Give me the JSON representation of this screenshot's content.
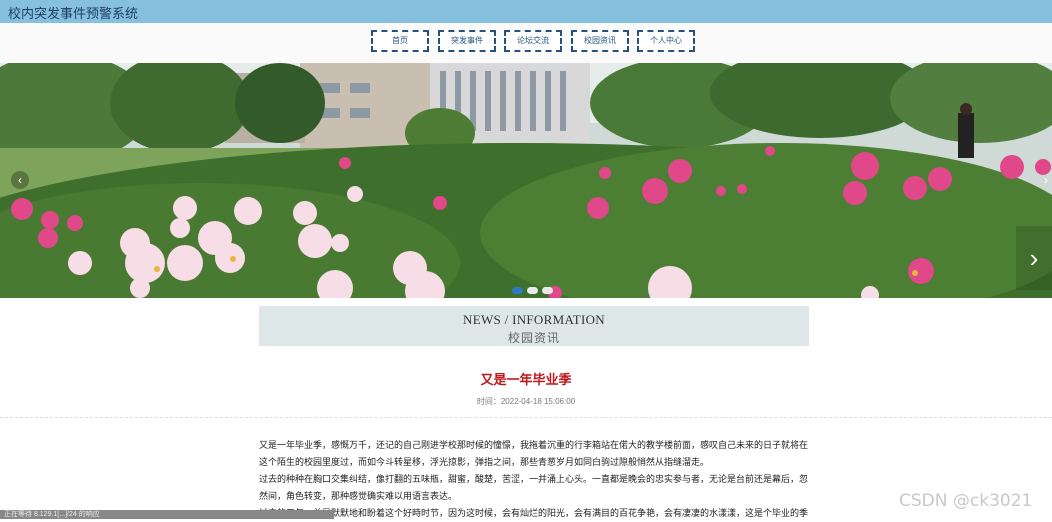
{
  "header": {
    "title": "校内突发事件预警系统"
  },
  "nav": [
    {
      "label": "首页"
    },
    {
      "label": "突发事件"
    },
    {
      "label": "论坛交流"
    },
    {
      "label": "校园资讯"
    },
    {
      "label": "个人中心"
    }
  ],
  "banner": {
    "prev_label": "‹",
    "next_label": "›",
    "slides": [
      {
        "active": true
      },
      {
        "active": false
      },
      {
        "active": false
      }
    ]
  },
  "news_section": {
    "heading_en": "NEWS / INFORMATION",
    "heading_cn": "校园资讯"
  },
  "article": {
    "title": "又是一年毕业季",
    "time": "时间：2022-04-18 15:06:00",
    "paragraphs": [
      "又是一年毕业季，感慨万千，还记的自己刚进学校那时候的憧憬，我拖着沉重的行李箱站在偌大的教学楼前面，感叹自己未来的日子就将在这个陌生的校园里度过，而如今斗转星移，浮光掠影，弹指之间，那些青葱岁月如同白驹过隙般悄然从指缝溜走。",
      "过去的种种在胸口交集纠结，像打翻的五味瓶，甜蜜，酸楚，苦涩，一并涌上心头。一直都是晚会的忠实参与者，无论是台前还是幕后，忽然间，角色转变，那种感觉确实难以用语言表达。",
      "过去的三年，总是默默地和盼着这个好時时节，因为这时候，会有灿烂的阳光，会有满目的百花争艳，会有凄凄的水漾漾，这是个毕业的季"
    ]
  },
  "status_text": "正在等待 8.129.1[...]/24 的响应",
  "watermark": "CSDN @ck3021"
}
